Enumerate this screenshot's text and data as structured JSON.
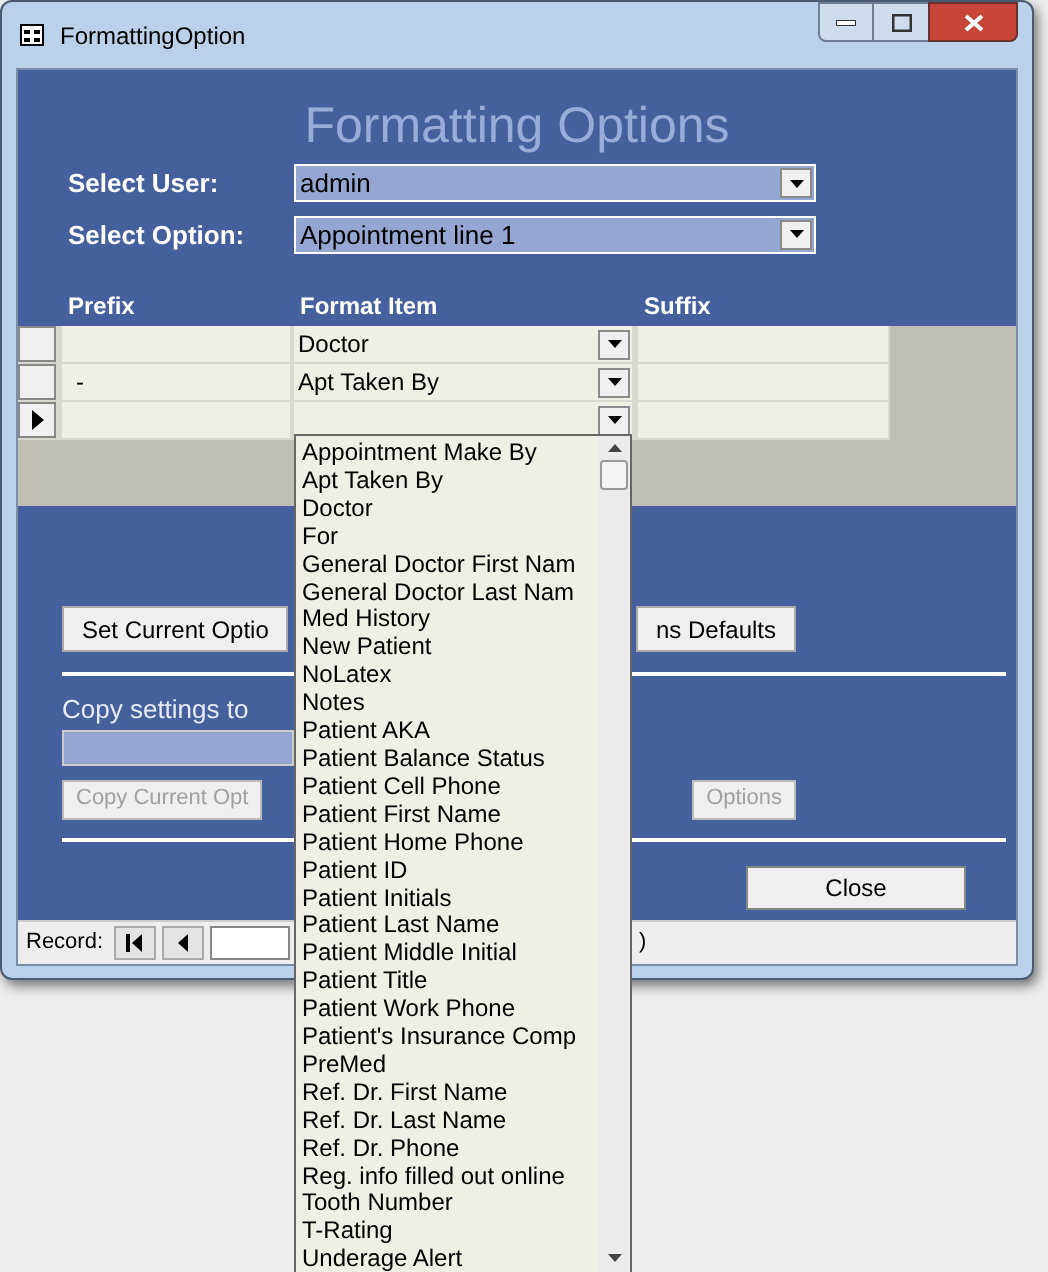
{
  "window": {
    "title": "FormattingOption"
  },
  "form": {
    "heading": "Formatting Options",
    "selectors": [
      {
        "label": "Select User:",
        "value": "admin"
      },
      {
        "label": "Select Option:",
        "value": "Appointment line 1"
      }
    ],
    "grid": {
      "columns": [
        "Prefix",
        "Format Item",
        "Suffix"
      ],
      "rows": [
        {
          "format_item": "Doctor",
          "current": false
        },
        {
          "prefix": "-",
          "format_item": "Apt Taken By",
          "current": false
        },
        {
          "current": true
        }
      ]
    },
    "set_buttons": [
      {
        "label": "Set Current Optio",
        "disabled": false
      },
      {
        "label": "ns Defaults",
        "disabled": false
      }
    ],
    "copy": {
      "label": "Copy settings to",
      "buttons": [
        {
          "label": "Copy Current Opt",
          "disabled": true
        },
        {
          "label": "Options",
          "disabled": true
        }
      ]
    },
    "close_button": "Close",
    "record_nav": {
      "label": "Record:",
      "tail": ")"
    }
  },
  "dropdown": {
    "items": [
      "Appointment Make By",
      "Apt Taken By",
      "Doctor",
      "For",
      "General Doctor First Nam",
      "General Doctor Last Nam",
      "Med History",
      "New Patient",
      "NoLatex",
      "Notes",
      "Patient AKA",
      "Patient Balance Status",
      "Patient Cell Phone",
      "Patient First Name",
      "Patient Home Phone",
      "Patient ID",
      "Patient Initials",
      "Patient Last Name",
      "Patient Middle Initial",
      "Patient Title",
      "Patient Work Phone",
      "Patient's Insurance Comp",
      "PreMed",
      "Ref. Dr. First Name",
      "Ref. Dr. Last Name",
      "Ref. Dr. Phone",
      "Reg. info filled out online",
      "Tooth Number",
      "T-Rating",
      "Underage Alert"
    ]
  }
}
